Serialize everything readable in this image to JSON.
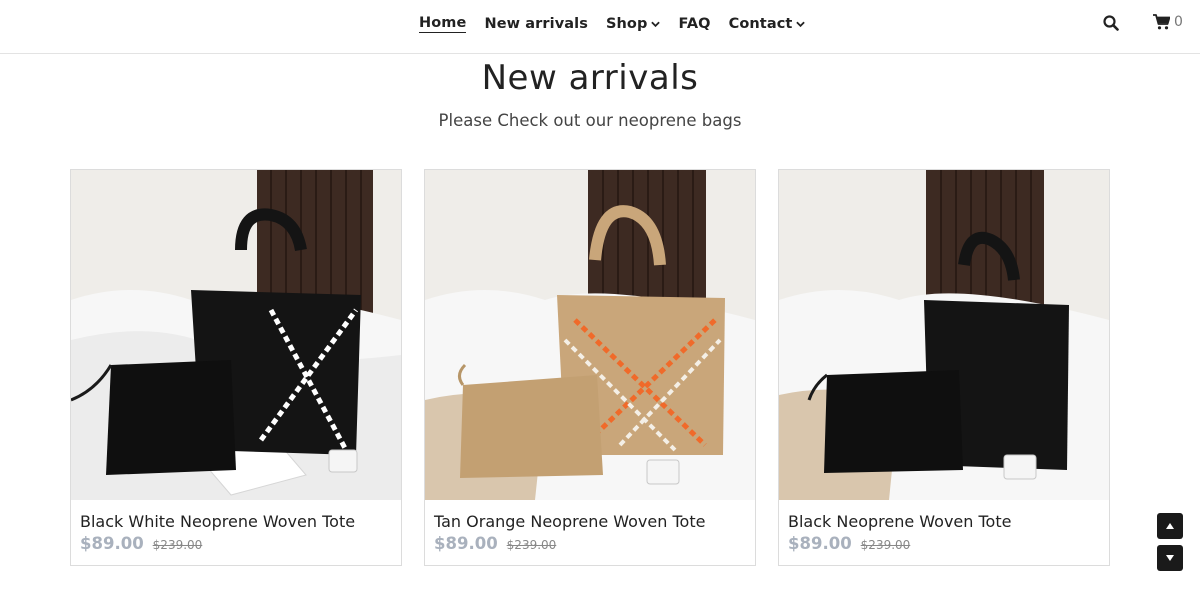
{
  "nav": {
    "items": [
      {
        "label": "Home",
        "active": true,
        "dropdown": false
      },
      {
        "label": "New arrivals",
        "active": false,
        "dropdown": false
      },
      {
        "label": "Shop",
        "active": false,
        "dropdown": true
      },
      {
        "label": "FAQ",
        "active": false,
        "dropdown": false
      },
      {
        "label": "Contact",
        "active": false,
        "dropdown": true
      }
    ],
    "search_icon": "search-icon",
    "cart_icon": "cart-icon",
    "cart_count": "0"
  },
  "page": {
    "title": "New arrivals",
    "subtitle": "Please Check out our neoprene bags"
  },
  "products": [
    {
      "name": "Black White Neoprene Woven Tote",
      "price": "$89.00",
      "compare_price": "$239.00",
      "bag_color": "#141414",
      "accent_colors": [
        "#ffffff"
      ]
    },
    {
      "name": "Tan Orange Neoprene Woven Tote",
      "price": "$89.00",
      "compare_price": "$239.00",
      "bag_color": "#c9a67a",
      "accent_colors": [
        "#f06a2a",
        "#f4efe6"
      ]
    },
    {
      "name": "Black Neoprene Woven Tote",
      "price": "$89.00",
      "compare_price": "$239.00",
      "bag_color": "#141414",
      "accent_colors": []
    }
  ],
  "scroll": {
    "up_icon": "scroll-up-icon",
    "down_icon": "scroll-down-icon"
  },
  "colors": {
    "text": "#222222",
    "price": "#a9b1bd",
    "button_bg": "#1a1a1a"
  }
}
